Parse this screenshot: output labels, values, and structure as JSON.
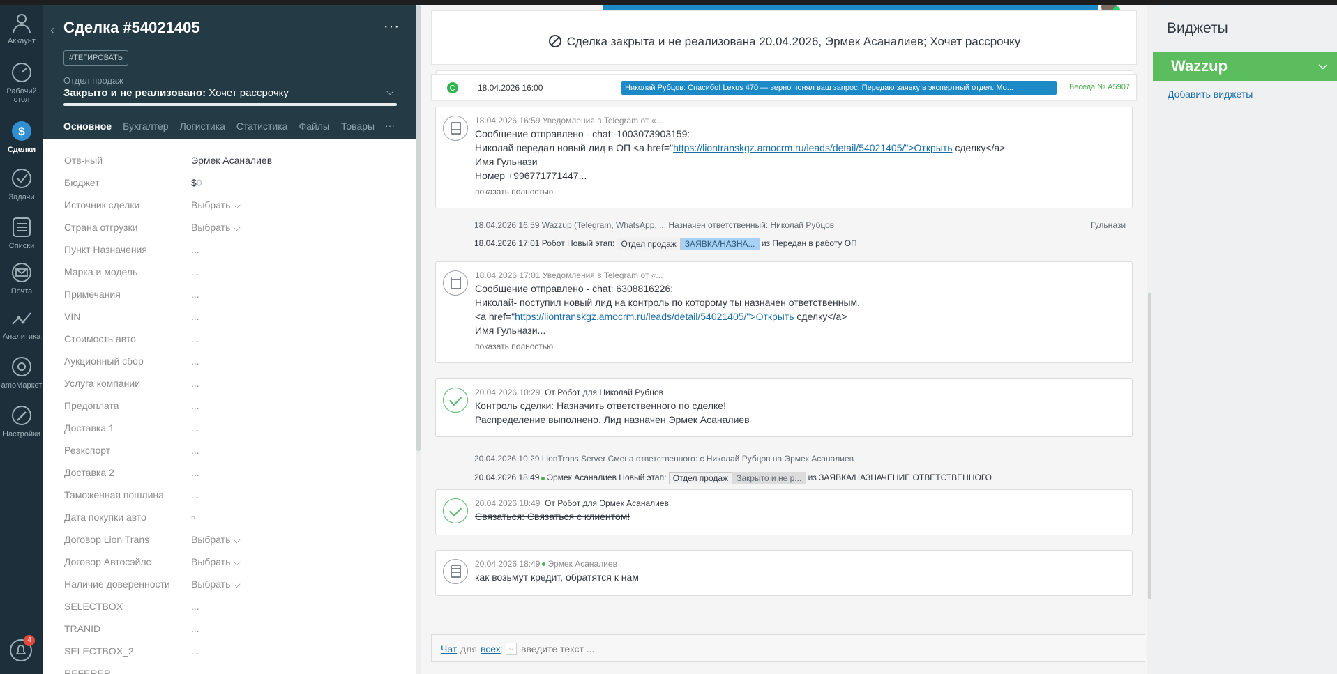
{
  "nav": {
    "items": [
      {
        "label": "Аккаунт",
        "icon": "account-icon"
      },
      {
        "label": "Рабочий стол",
        "icon": "dashboard-icon"
      },
      {
        "label": "Сделки",
        "icon": "deals-icon"
      },
      {
        "label": "Задачи",
        "icon": "tasks-icon"
      },
      {
        "label": "Списки",
        "icon": "lists-icon"
      },
      {
        "label": "Почта",
        "icon": "mail-icon"
      },
      {
        "label": "Аналитика",
        "icon": "analytics-icon"
      },
      {
        "label": "amoМаркет",
        "icon": "market-icon"
      },
      {
        "label": "Настройки",
        "icon": "settings-icon"
      }
    ],
    "notifications_count": "4"
  },
  "lead": {
    "title": "Сделка #54021405",
    "tag_button": "#ТЕГИРОВАТЬ",
    "pipeline_label": "Отдел продаж",
    "status_bold": "Закрыто и не реализовано:",
    "status_rest": " Хочет рассрочку",
    "tabs": [
      "Основное",
      "Бухгалтер",
      "Логистика",
      "Статистика",
      "Файлы",
      "Товары"
    ],
    "tabs_more": "···",
    "fields": [
      {
        "label": "Отв-ный",
        "value": "Эрмек Асаналиев"
      },
      {
        "label": "Бюджет",
        "value": "$",
        "value_extra": "0"
      },
      {
        "label": "Источник сделки",
        "value": "Выбрать ⌵"
      },
      {
        "label": "Страна отгрузки",
        "value": "Выбрать ⌵"
      },
      {
        "label": "Пункт Назначения",
        "value": "..."
      },
      {
        "label": "Марка и модель",
        "value": "..."
      },
      {
        "label": "Примечания",
        "value": "..."
      },
      {
        "label": "VIN",
        "value": "..."
      },
      {
        "label": "Стоимость авто",
        "value": "..."
      },
      {
        "label": "Аукционный сбор",
        "value": "..."
      },
      {
        "label": "Услуга компании",
        "value": "..."
      },
      {
        "label": "Предоплата",
        "value": "..."
      },
      {
        "label": "Доставка 1",
        "value": "..."
      },
      {
        "label": "Реэкспорт",
        "value": "..."
      },
      {
        "label": "Доставка 2",
        "value": "..."
      },
      {
        "label": "Таможенная пошлина",
        "value": "..."
      },
      {
        "label": "Дата покупки авто",
        "value": "▫"
      },
      {
        "label": "Договор Lion Trans",
        "value": "Выбрать ⌵"
      },
      {
        "label": "Договор Автосэйлс",
        "value": "Выбрать ⌵"
      },
      {
        "label": "Наличие доверенности",
        "value": "Выбрать ⌵"
      },
      {
        "label": "SELECTBOX",
        "value": "..."
      },
      {
        "label": "TRANID",
        "value": "..."
      },
      {
        "label": "SELECTBOX_2",
        "value": "..."
      },
      {
        "label": "REFERER",
        "value": ""
      }
    ]
  },
  "feed": {
    "closed_text": "Сделка закрыта и не реализована 20.04.2026, Эрмек Асаналиев; Хочет рассрочку",
    "wa": {
      "date": "18.04.2026 16:00",
      "message": "Николай Рубцов: Спасибо! Lexus 470 — верно понял ваш запрос. Передаю заявку в экспертный отдел. Мо...",
      "chat": "Беседа № A5907"
    },
    "note1": {
      "meta": "18.04.2026 16:59 Уведомления в Telegram от «...",
      "l1": "Сообщение отправлено - chat:-1003073903159:",
      "l2a": "Николай передал новый лид в ОП <a href=\"",
      "l2link": "https://liontranskgz.amocrm.ru/leads/detail/54021405/\">Открыть",
      "l2b": " сделку</a>",
      "l3": "Имя Гульнази",
      "l4": "Номер +996771771447...",
      "more": "показать полностью"
    },
    "sys1": {
      "text": "18.04.2026 16:59 Wazzup (Telegram, WhatsApp, ... Назначен ответственный: Николай Рубцов",
      "link": "Гульнази"
    },
    "sys2": {
      "prefix": "18.04.2026 17:01 Робот Новый этап:",
      "stage1": "Отдел продаж",
      "stage2": "ЗАЯВКА/НАЗНА...",
      "suffix": "из Передан в работу ОП"
    },
    "note2": {
      "meta": "18.04.2026 17:01 Уведомления в Telegram от «...",
      "l1": "Сообщение отправлено - chat: 6308816226:",
      "l2": "Николай- поступил новый лид на контроль по которому ты назначен ответственным.",
      "l3a": "<a href=\"",
      "l3link": "https://liontranskgz.amocrm.ru/leads/detail/54021405/\">Открыть",
      "l3b": " сделку</a>",
      "l4": "Имя Гульнази...",
      "more": "показать полностью"
    },
    "task1": {
      "date": "20.04.2026 10:29",
      "who": "От Робот для Николай Рубцов",
      "l1": "Контроль сделки: Назначить ответственного по сделке!",
      "l2": "Распределение выполнено. Лид назначен Эрмек Асаналиев"
    },
    "sys3": {
      "text": "20.04.2026 10:29 LionTrans Server Смена ответственного: с Николай Рубцов на Эрмек Асаналиев"
    },
    "sys4": {
      "prefix": "20.04.2026 18:49",
      "who": "Эрмек Асаналиев Новый этап:",
      "stage1": "Отдел продаж",
      "stage2": "Закрыто и не р...",
      "suffix": "из ЗАЯВКА/НАЗНАЧЕНИЕ ОТВЕТСТВЕННОГО"
    },
    "task2": {
      "date": "20.04.2026 18:49",
      "who": "От Робот для Эрмек Асаналиев",
      "l1": "Связаться: Связаться с клиентом!"
    },
    "note3": {
      "date": "20.04.2026 18:49",
      "who": "Эрмек Асаналиев",
      "l1": "как возьмут кредит, обратятся к нам"
    },
    "chat": {
      "chat_label": "Чат",
      "for_label": "для",
      "all_label": "всех",
      "colon": ":",
      "placeholder": "введите текст ..."
    }
  },
  "widgets": {
    "title": "Виджеты",
    "wazzup": "Wazzup",
    "add": "Добавить виджеты"
  },
  "colors": {
    "nav_bg": "#1c2f3a",
    "header_bg": "#243b45",
    "accent_blue": "#1d8ac8",
    "wazzup_green": "#5cbd5f"
  }
}
